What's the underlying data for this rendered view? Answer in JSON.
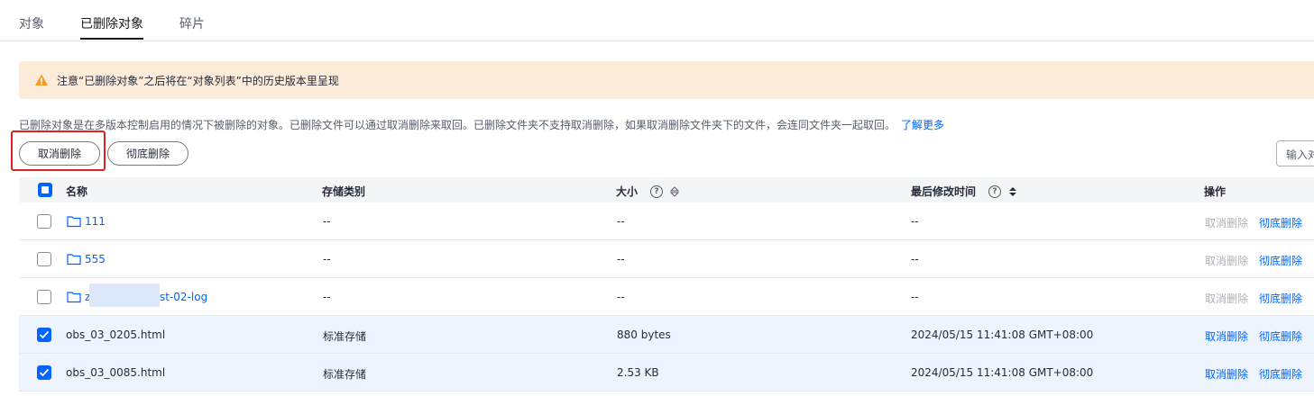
{
  "tabs": [
    {
      "label": "对象",
      "active": false
    },
    {
      "label": "已删除对象",
      "active": true
    },
    {
      "label": "碎片",
      "active": false
    }
  ],
  "notice": {
    "text": "注意“已删除对象”之后将在“对象列表”中的历史版本里呈现"
  },
  "description": {
    "text": "已删除对象是在多版本控制启用的情况下被删除的对象。已删除文件可以通过取消删除来取回。已删除文件夹不支持取消删除，如果取消删除文件夹下的文件，会连同文件夹一起取回。",
    "link": "了解更多"
  },
  "toolbar": {
    "undelete_label": "取消删除",
    "delete_permanently_label": "彻底删除",
    "search_placeholder": "输入对"
  },
  "table": {
    "headers": {
      "name": "名称",
      "storage_class": "存储类别",
      "size": "大小",
      "modified": "最后修改时间",
      "actions": "操作"
    },
    "rows": [
      {
        "name": "111",
        "is_folder": true,
        "storage_class": "--",
        "size": "--",
        "modified": "--",
        "checked": false,
        "undelete": "取消删除",
        "delete": "彻底删除",
        "undelete_enabled": false
      },
      {
        "name": "555",
        "is_folder": true,
        "storage_class": "--",
        "size": "--",
        "modified": "--",
        "checked": false,
        "undelete": "取消删除",
        "delete": "彻底删除",
        "undelete_enabled": false
      },
      {
        "name": "z",
        "name_suffix": "st-02-log",
        "is_folder": true,
        "storage_class": "--",
        "size": "--",
        "modified": "--",
        "checked": false,
        "undelete": "取消删除",
        "delete": "彻底删除",
        "undelete_enabled": false
      },
      {
        "name": "obs_03_0205.html",
        "is_folder": false,
        "storage_class": "标准存储",
        "size": "880 bytes",
        "modified": "2024/05/15 11:41:08 GMT+08:00",
        "checked": true,
        "undelete": "取消删除",
        "delete": "彻底删除",
        "undelete_enabled": true
      },
      {
        "name": "obs_03_0085.html",
        "is_folder": false,
        "storage_class": "标准存储",
        "size": "2.53 KB",
        "modified": "2024/05/15 11:41:08 GMT+08:00",
        "checked": true,
        "undelete": "取消删除",
        "delete": "彻底删除",
        "undelete_enabled": true
      }
    ]
  },
  "colors": {
    "accent": "#0065ff",
    "notice_bg": "#fdebd9",
    "warning": "#f59a23",
    "highlight_border": "#e02020"
  }
}
